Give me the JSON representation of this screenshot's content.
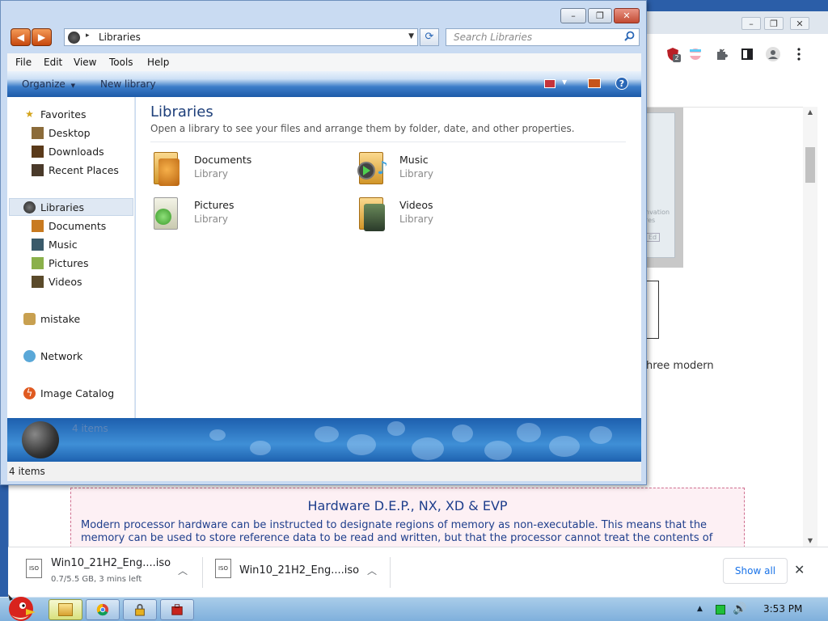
{
  "browser": {
    "window_buttons": [
      "–",
      "❐",
      "✕"
    ],
    "tab_dropdown": "⌄",
    "extensions": [
      {
        "name": "shield-extension-icon",
        "badge": "2"
      },
      {
        "name": "flag-extension-icon"
      },
      {
        "name": "puzzle-icon"
      },
      {
        "name": "sidepanel-icon"
      },
      {
        "name": "profile-icon"
      },
      {
        "name": "kebab-menu-icon"
      }
    ],
    "thumb_text": [
      "nvation",
      "res",
      "Ed"
    ],
    "article_snippet": "hree modern",
    "hw_box": {
      "title": "Hardware D.E.P., NX, XD & EVP",
      "text": "Modern processor hardware can be instructed to designate regions of memory as non-executable. This means that the memory can be used to store reference data to be read and written, but that the processor cannot treat the contents of"
    },
    "downloads": [
      {
        "name": "Win10_21H2_Eng....iso",
        "status": "0.7/5.5 GB, 3 mins left",
        "icon_label": "ISO"
      },
      {
        "name": "Win10_21H2_Eng....iso",
        "status": "",
        "icon_label": "ISO"
      }
    ],
    "show_all": "Show all",
    "close_downloads": "✕"
  },
  "explorer": {
    "address": {
      "location": "Libraries",
      "separator": "▸"
    },
    "search_placeholder": "Search Libraries",
    "menu": [
      "File",
      "Edit",
      "View",
      "Tools",
      "Help"
    ],
    "command_bar": {
      "organize": "Organize",
      "organize_arrow": "▼",
      "new_library": "New library"
    },
    "nav": {
      "favorites": {
        "label": "Favorites",
        "items": [
          "Desktop",
          "Downloads",
          "Recent Places"
        ]
      },
      "libraries": {
        "label": "Libraries",
        "items": [
          "Documents",
          "Music",
          "Pictures",
          "Videos"
        ]
      },
      "homegroup": "mistake",
      "network": "Network",
      "catalog": "Image Catalog"
    },
    "content": {
      "title": "Libraries",
      "description": "Open a library to see your files and arrange them by folder, date, and other properties.",
      "libraries": [
        {
          "name": "Documents",
          "type": "Library"
        },
        {
          "name": "Music",
          "type": "Library"
        },
        {
          "name": "Pictures",
          "type": "Library"
        },
        {
          "name": "Videos",
          "type": "Library"
        }
      ]
    },
    "details_count": "4 items",
    "status_count": "4 items"
  },
  "taskbar": {
    "clock": "3:53 PM",
    "tray_arrow": "▲"
  },
  "colors": {
    "window_frame": "#c9dbf2",
    "command_bar_dark": "#1d5aa8",
    "title_text": "#1e3f7a",
    "hw_box_bg": "#fdf0f4",
    "link_blue": "#1a73e8"
  }
}
